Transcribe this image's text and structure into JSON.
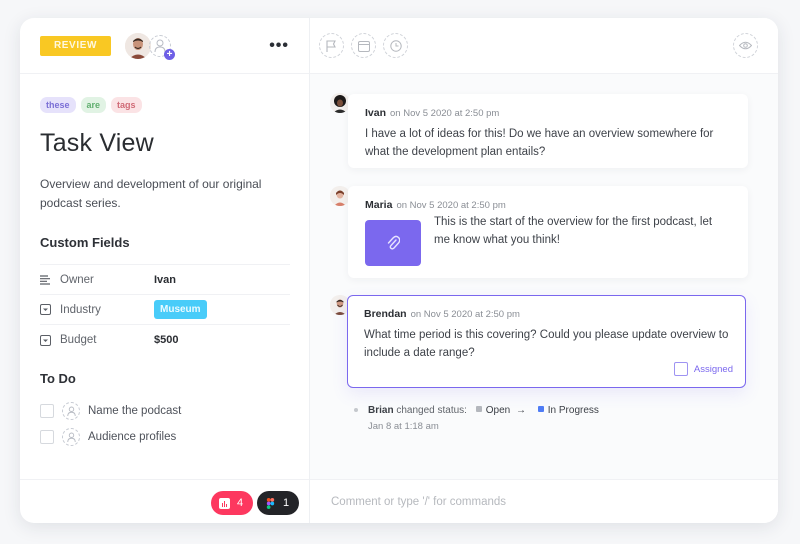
{
  "task": {
    "status_label": "REVIEW",
    "tags": [
      "these",
      "are",
      "tags"
    ],
    "title": "Task View",
    "description": "Overview and development of our original podcast series.",
    "more_icon": "•••"
  },
  "custom_fields": {
    "heading": "Custom Fields",
    "rows": [
      {
        "label": "Owner",
        "value": "Ivan",
        "icon": "text-lines-icon"
      },
      {
        "label": "Industry",
        "value": "Museum",
        "icon": "dropdown-icon"
      },
      {
        "label": "Budget",
        "value": "$500",
        "icon": "dropdown-icon"
      }
    ]
  },
  "todo": {
    "heading": "To Do",
    "items": [
      "Name the podcast",
      "Audience profiles"
    ]
  },
  "footer_badges": [
    {
      "count": "4",
      "color": "#fd385f"
    },
    {
      "count": "1",
      "color": "#232428"
    }
  ],
  "comments": [
    {
      "author": "Ivan",
      "time": "on Nov 5 2020 at 2:50 pm",
      "text": "I have a lot of ideas for this! Do we have an overview somewhere for what the development plan entails?"
    },
    {
      "author": "Maria",
      "time": "on Nov 5 2020 at 2:50 pm",
      "text": "This is the start of the overview for the first podcast, let me know what you think!"
    },
    {
      "author": "Brendan",
      "time": "on Nov 5 2020 at 2:50 pm",
      "text": "What time period is this covering? Could you please update overview to include a date range?",
      "assigned_label": "Assigned"
    }
  ],
  "activity": {
    "actor": "Brian",
    "action": "changed status:",
    "from": "Open",
    "arrow": "→",
    "to": "In Progress",
    "from_color": "#b4b7bd",
    "to_color": "#4f7cf5",
    "time": "Jan 8 at 1:18 am"
  },
  "comment_box": {
    "placeholder": "Comment or type '/' for commands"
  },
  "colors": {
    "accent": "#7b68ee",
    "review": "#f9c823",
    "museum": "#49ccf9"
  }
}
